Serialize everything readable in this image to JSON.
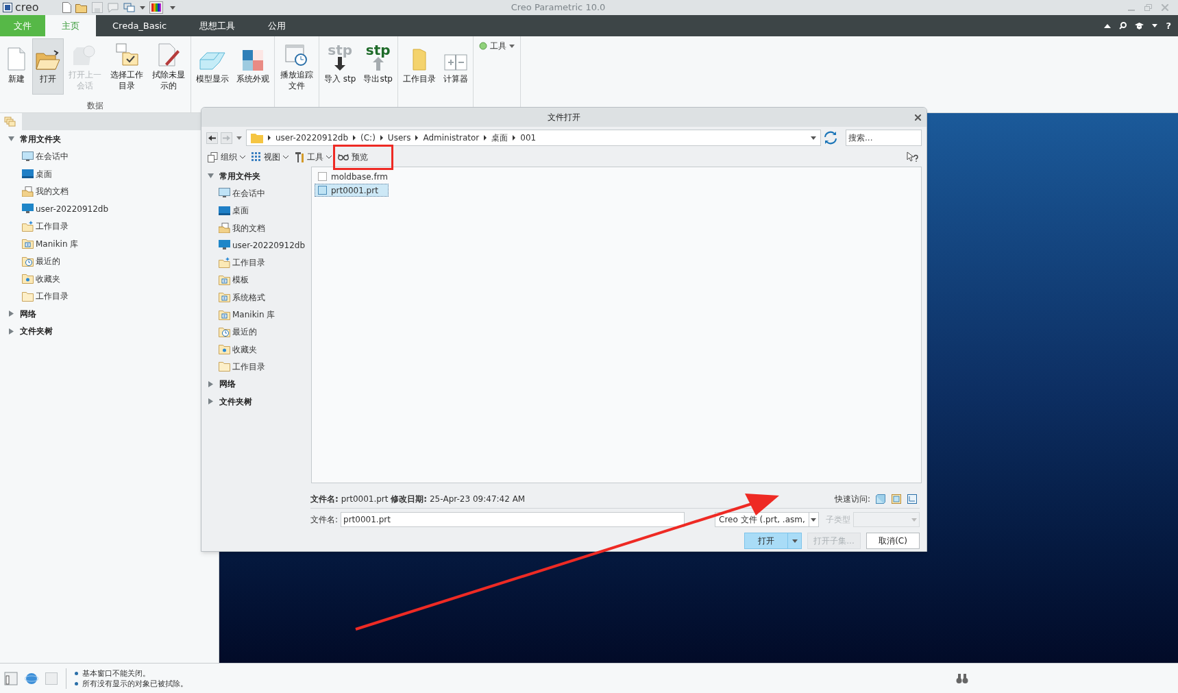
{
  "app": {
    "logo": "creo",
    "title": "Creo Parametric 10.0"
  },
  "ribbon_tabs": [
    {
      "label": "文件",
      "kind": "file",
      "selected": false
    },
    {
      "label": "主页",
      "kind": "tab",
      "selected": true
    },
    {
      "label": "Creda_Basic",
      "kind": "tab",
      "selected": false
    },
    {
      "label": "思想工具",
      "kind": "tab",
      "selected": false
    },
    {
      "label": "公用",
      "kind": "tab",
      "selected": false
    }
  ],
  "help": "?",
  "ribbon_groups": [
    {
      "label": "数据",
      "buttons": [
        {
          "label": "新建",
          "kind": "new",
          "selected": false,
          "disabled": false
        },
        {
          "label": "打开",
          "kind": "open",
          "selected": true,
          "disabled": false
        },
        {
          "label": "打开上一会话",
          "kind": "session",
          "selected": false,
          "disabled": true
        },
        {
          "label": "选择工作目录",
          "kind": "workdir",
          "selected": false,
          "disabled": false
        },
        {
          "label": "拭除未显示的",
          "kind": "erase",
          "selected": false,
          "disabled": false
        }
      ]
    },
    {
      "buttons": [
        {
          "label": "模型显示",
          "kind": "display",
          "selected": false,
          "disabled": false
        },
        {
          "label": "系统外观",
          "kind": "appearance",
          "selected": false,
          "disabled": false
        }
      ]
    },
    {
      "buttons": [
        {
          "label": "播放追踪文件",
          "kind": "trail",
          "selected": false,
          "disabled": false
        }
      ]
    },
    {
      "buttons": [
        {
          "label": "导入 stp",
          "kind": "import",
          "icon_text": "stp",
          "selected": false,
          "disabled": false
        },
        {
          "label": "导出stp",
          "kind": "export",
          "icon_text": "stp",
          "selected": false,
          "disabled": false
        }
      ]
    },
    {
      "buttons": [
        {
          "label": "工作目录",
          "kind": "folder",
          "selected": false,
          "disabled": false
        },
        {
          "label": "计算器",
          "kind": "calculator",
          "selected": false,
          "disabled": false
        }
      ]
    },
    {
      "buttons": [
        {
          "label": "工具",
          "kind": "small",
          "selected": false,
          "disabled": false
        }
      ]
    }
  ],
  "navigator": {
    "sections": [
      {
        "label": "常用文件夹",
        "expanded": true,
        "children": [
          {
            "label": "在会话中",
            "kind": "session"
          },
          {
            "label": "桌面",
            "kind": "desktop"
          },
          {
            "label": "我的文档",
            "kind": "documents"
          },
          {
            "label": "user-20220912db",
            "kind": "computer"
          },
          {
            "label": "工作目录",
            "kind": "workdir"
          },
          {
            "label": "Manikin 库",
            "kind": "library"
          },
          {
            "label": "最近的",
            "kind": "recent"
          },
          {
            "label": "收藏夹",
            "kind": "favorites"
          },
          {
            "label": "工作目录",
            "kind": "folder"
          }
        ]
      },
      {
        "label": "网络",
        "expanded": false
      },
      {
        "label": "文件夹树",
        "expanded": false
      }
    ]
  },
  "dialog": {
    "title": "文件打开",
    "path": [
      "user-20220912db",
      "(C:)",
      "Users",
      "Administrator",
      "桌面",
      "001"
    ],
    "search": {
      "placeholder": "搜索..."
    },
    "toolbar": [
      {
        "label": "组织",
        "kind": "organize",
        "dropdown": true
      },
      {
        "label": "视图",
        "kind": "view",
        "dropdown": true
      },
      {
        "label": "工具",
        "kind": "tools",
        "dropdown": true
      },
      {
        "label": "预览",
        "kind": "preview",
        "dropdown": false
      }
    ],
    "tree": {
      "sections": [
        {
          "label": "常用文件夹",
          "expanded": true,
          "children": [
            {
              "label": "在会话中",
              "kind": "session"
            },
            {
              "label": "桌面",
              "kind": "desktop"
            },
            {
              "label": "我的文档",
              "kind": "documents"
            },
            {
              "label": "user-20220912db",
              "kind": "computer"
            },
            {
              "label": "工作目录",
              "kind": "workdir"
            },
            {
              "label": "模板",
              "kind": "library"
            },
            {
              "label": "系统格式",
              "kind": "library"
            },
            {
              "label": "Manikin 库",
              "kind": "library"
            },
            {
              "label": "最近的",
              "kind": "recent"
            },
            {
              "label": "收藏夹",
              "kind": "favorites"
            },
            {
              "label": "工作目录",
              "kind": "folder"
            }
          ]
        },
        {
          "label": "网络",
          "expanded": false
        },
        {
          "label": "文件夹树",
          "expanded": false
        }
      ]
    },
    "files": [
      {
        "name": "moldbase.frm",
        "kind": "frm",
        "selected": false
      },
      {
        "name": "prt0001.prt",
        "kind": "prt",
        "selected": true
      }
    ],
    "info": "**文件名:** prt0001.prt **修改日期:** 25-Apr-23 09:47:42 AM",
    "quick_access_label": "快速访问:",
    "filename": {
      "label": "文件名:",
      "value": "prt0001.prt"
    },
    "type": {
      "value": "Creo 文件 (.prt, .asm,"
    },
    "subtype": {
      "label": "子类型",
      "disabled": true
    },
    "buttons": [
      {
        "label": "打开",
        "kind": "primary",
        "disabled": false
      },
      {
        "label": "打开子集...",
        "kind": "normal",
        "disabled": true
      },
      {
        "label": "取消(C)",
        "kind": "normal",
        "disabled": false
      }
    ]
  },
  "status": {
    "messages": [
      "基本窗口不能关闭。",
      "所有没有显示的对象已被拭除。"
    ]
  }
}
